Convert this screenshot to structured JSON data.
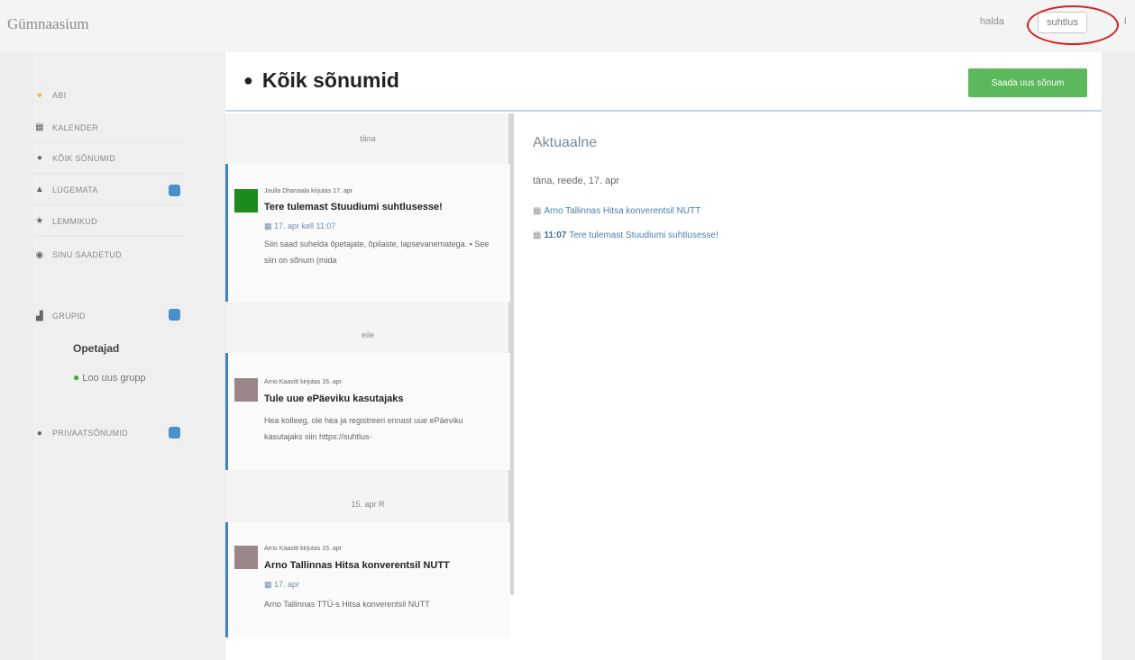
{
  "app": {
    "brand": "Gümnaasium"
  },
  "topnav": {
    "manage": "halda",
    "active": "suhtlus"
  },
  "sidebar": {
    "items": [
      {
        "label": "ABI",
        "icon": "lightbulb-icon",
        "glyph": "♥"
      },
      {
        "label": "KALENDER",
        "icon": "calendar-icon",
        "glyph": "▦"
      },
      {
        "label": "KÕIK SÕNUMID",
        "icon": "chat-icon",
        "glyph": "●"
      },
      {
        "label": "LUGEMATA",
        "icon": "bell-icon",
        "glyph": "▲"
      },
      {
        "label": "LEMMIKUD",
        "icon": "star-icon",
        "glyph": "★"
      },
      {
        "label": "SINU SAADETUD",
        "icon": "send-icon",
        "glyph": "◉"
      }
    ],
    "groups": {
      "label": "GRUPID",
      "icon": "group-icon",
      "glyph": "▟"
    },
    "section_title": "Opetajad",
    "new_group": "Loo uus grupp",
    "private": {
      "label": "PRIVAATSÕNUMID",
      "icon": "private-chat-icon",
      "glyph": "●"
    },
    "badge_color": "#4a90c8"
  },
  "main": {
    "title": "Kõik sõnumid",
    "send_button": "Saada uus sõnum",
    "accent": "#5cb85c"
  },
  "messages": {
    "groups": [
      {
        "date": "täna",
        "author_line": "Joulla Dhanaala kirjutas 17. apr",
        "subject": "Tere tulemast Stuudiumi suhtlusesse!",
        "sent": "17. apr kell 11:07",
        "excerpt": "Siin saad suhelda õpetajate, õpilaste, lapsevanematega. ▪ See siin on sõnum (mida",
        "avatar_color": "#1d8a1d"
      },
      {
        "date": "eile",
        "author_line": "Arno Kaasitt kirjutas 16. apr",
        "subject": "Tule uue ePäeviku kasutajaks",
        "sent": "",
        "excerpt": "Hea kolleeg, ole hea ja registreeri ennast uue ePäeviku kasutajaks siin https://suhtlus-",
        "avatar_color": "#9a8588"
      },
      {
        "date": "15. apr R",
        "author_line": "Arno Kaasitt kirjutas 15. apr",
        "subject": "Arno Tallinnas Hitsa konverentsil NUTT",
        "sent": "17. apr",
        "excerpt": "Arno Tallinnas TTÜ-s Hitsa konverentsil NUTT",
        "avatar_color": "#9a8588"
      }
    ]
  },
  "panel": {
    "title": "Aktuaalne",
    "day": "täna, reede, 17. apr",
    "events": [
      {
        "time": "",
        "text": "Arno Tallinnas Hitsa konverentsil NUTT"
      },
      {
        "time": "11:07",
        "text": "Tere tulemast Stuudiumi suhtlusesse!"
      }
    ]
  }
}
